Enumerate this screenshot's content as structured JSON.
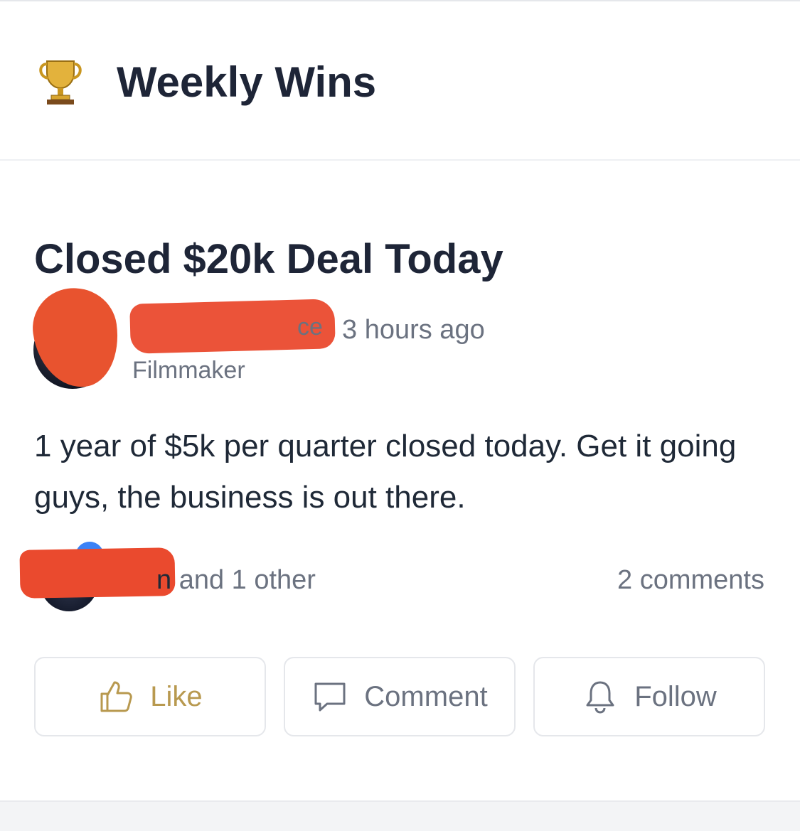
{
  "header": {
    "icon": "trophy-icon",
    "title": "Weekly Wins"
  },
  "post": {
    "title": "Closed $20k Deal Today",
    "author_name_visible_fragment": "ce",
    "timestamp": "3 hours ago",
    "author_role": "Filmmaker",
    "body": "1 year of $5k per quarter closed today. Get it going guys, the business is out there.",
    "reactions_name_fragment": "n",
    "reactions_text": " and 1 other",
    "comments_count": "2 comments"
  },
  "actions": {
    "like_label": "Like",
    "comment_label": "Comment",
    "follow_label": "Follow"
  },
  "colors": {
    "accent_like": "#b8994f",
    "redaction": "#ea4a2e",
    "title_text": "#1e2537",
    "muted_text": "#6b7280"
  }
}
